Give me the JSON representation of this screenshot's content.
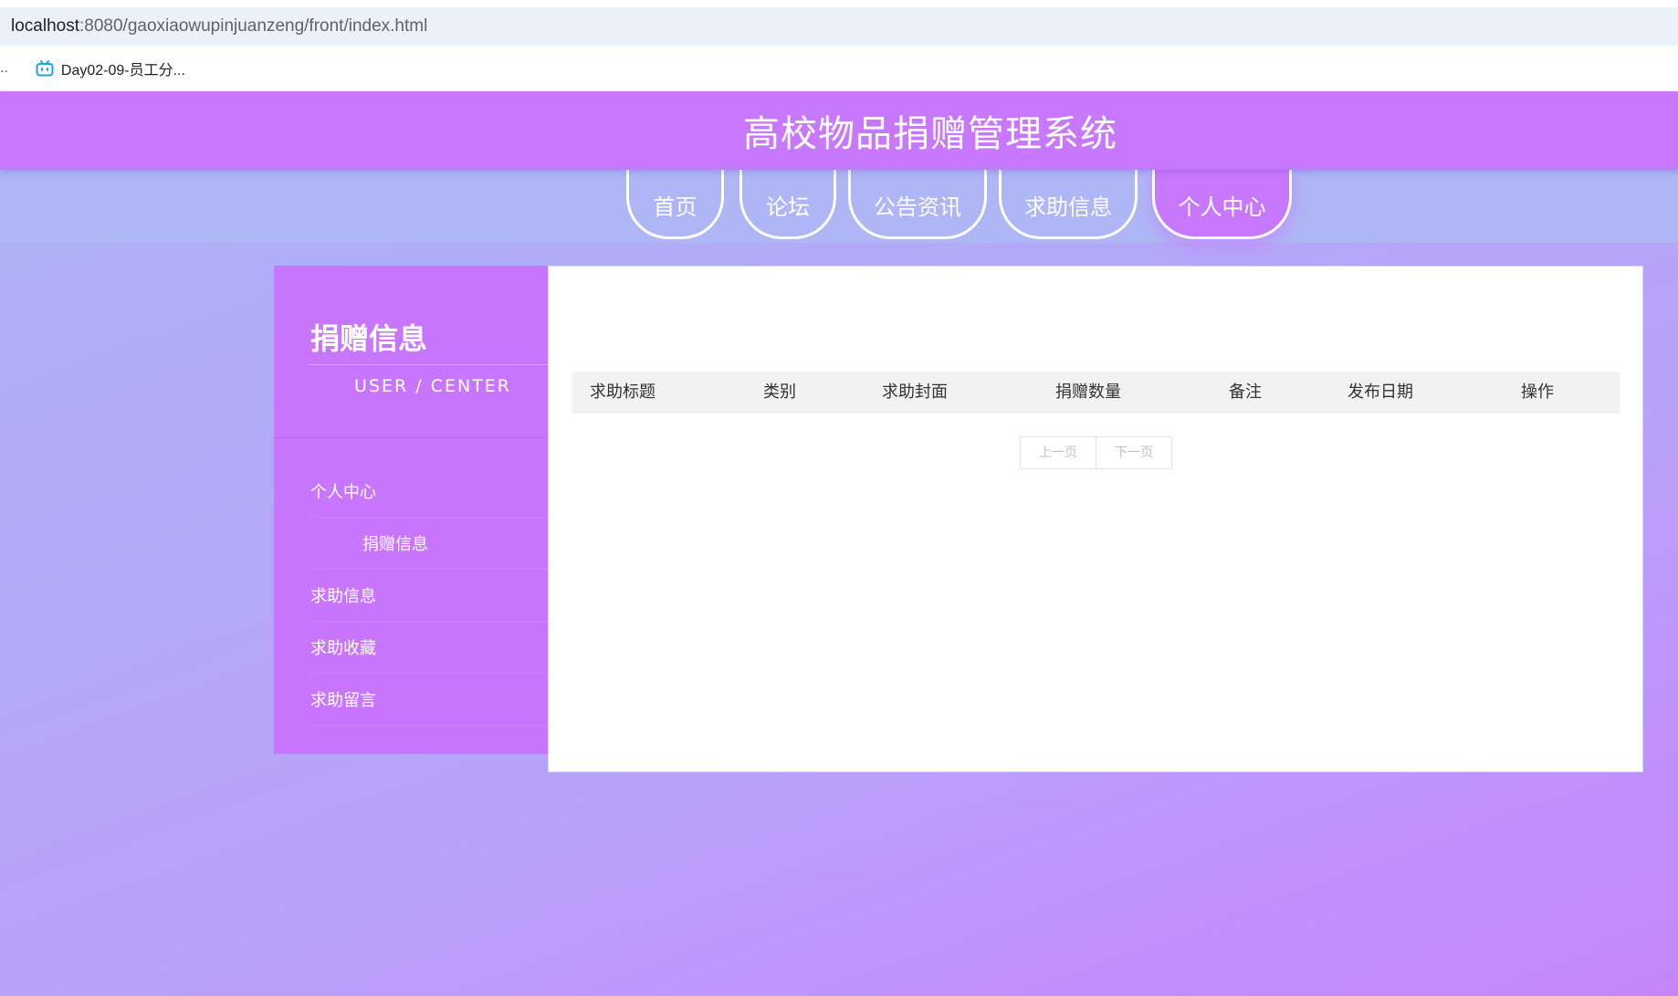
{
  "browser": {
    "url_host": "localhost",
    "url_rest": ":8080/gaoxiaowupinjuanzeng/front/index.html",
    "bookmarks_ellipsis": "..",
    "bookmark_label": "Day02-09-员工分..."
  },
  "header": {
    "title": "高校物品捐赠管理系统"
  },
  "nav": {
    "items": [
      {
        "label": "首页"
      },
      {
        "label": "论坛"
      },
      {
        "label": "公告资讯"
      },
      {
        "label": "求助信息"
      },
      {
        "label": "个人中心",
        "active": true
      }
    ]
  },
  "sidebar": {
    "heading": "捐赠信息",
    "subheading": "USER / CENTER",
    "menu": [
      {
        "label": "个人中心"
      },
      {
        "label": "捐赠信息",
        "sub": true
      },
      {
        "label": "求助信息"
      },
      {
        "label": "求助收藏"
      },
      {
        "label": "求助留言"
      }
    ]
  },
  "table": {
    "columns": [
      "求助标题",
      "类别",
      "求助封面",
      "捐赠数量",
      "备注",
      "发布日期",
      "操作"
    ],
    "rows": []
  },
  "pager": {
    "prev_label": "上一页",
    "next_label": "下一页"
  },
  "colors": {
    "primary": "#c778ff",
    "nav_bar": "#aeb6f5",
    "bookmark_icon": "#1ea2e2"
  }
}
